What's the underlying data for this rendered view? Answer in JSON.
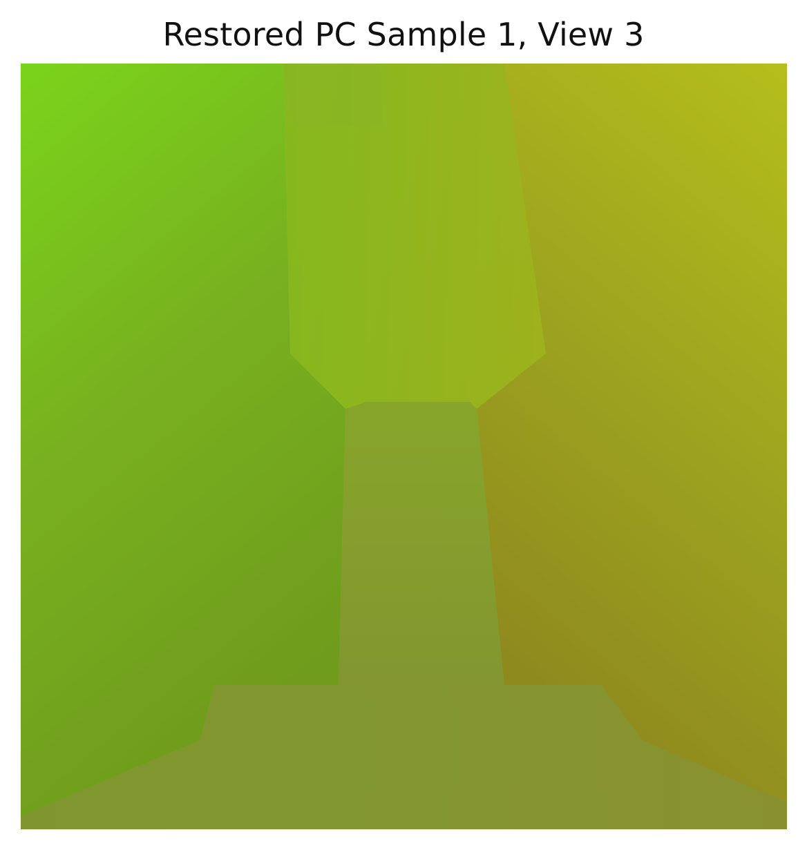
{
  "figure": {
    "title": "Restored PC Sample 1, View 3"
  },
  "colors": {
    "top_left": "#76d31a",
    "top_right": "#b4bd1a",
    "bottom_left": "#6e9a1c",
    "bottom_right": "#8f8a1c",
    "center_pillar": "#839a2e",
    "floor": "#84932f"
  }
}
